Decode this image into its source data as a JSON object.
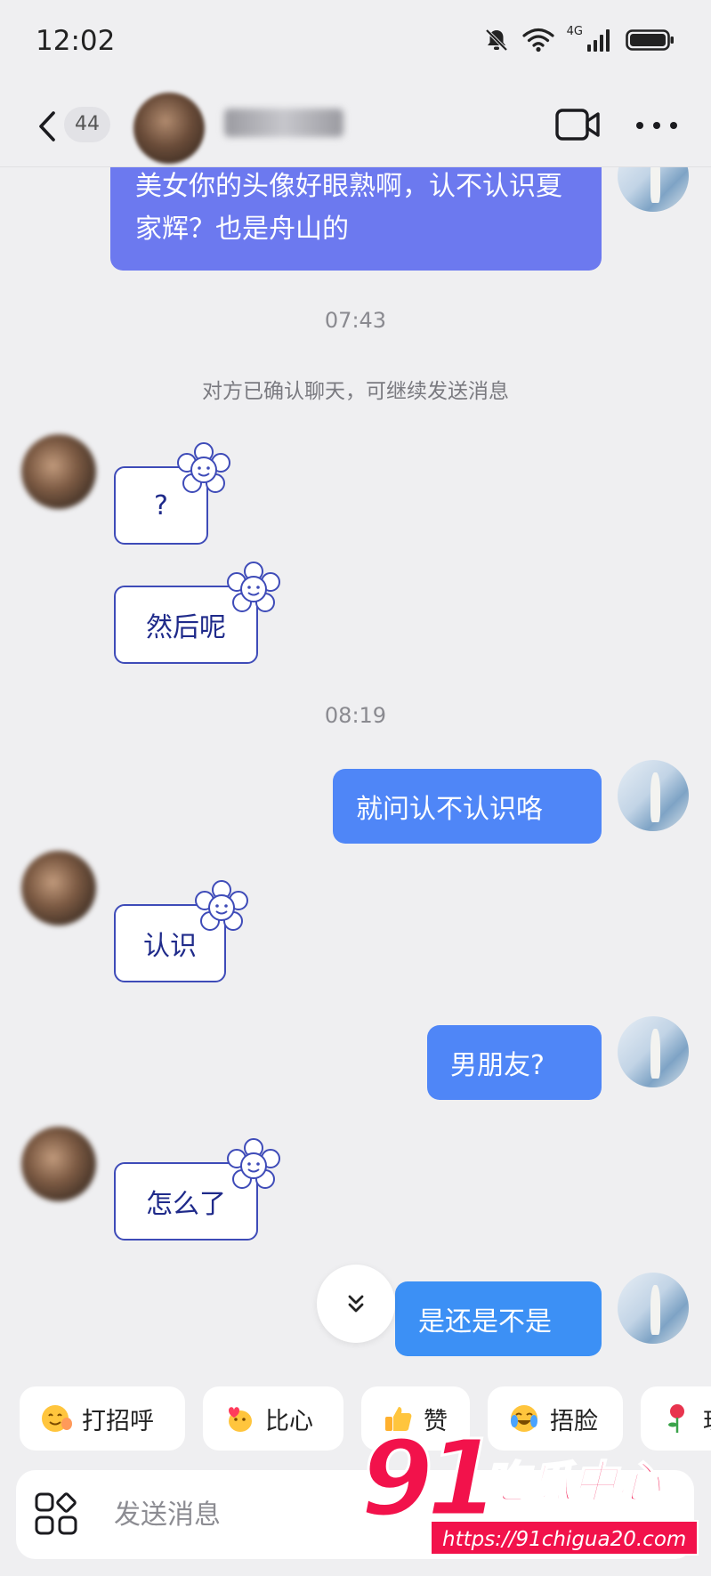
{
  "status_bar": {
    "time": "12:02",
    "network_label": "4G"
  },
  "header": {
    "unread_count": "44"
  },
  "messages": {
    "first_out": "美女你的头像好眼熟啊，认不认识夏家辉？也是舟山的",
    "time_1": "07:43",
    "system_note": "对方已确认聊天，可继续发送消息",
    "in_1": "?",
    "in_2": "然后呢",
    "time_2": "08:19",
    "out_1": "就问认不认识咯",
    "in_3": "认识",
    "out_2": "男朋友?",
    "in_4": "怎么了",
    "out_3": "是还是不是"
  },
  "quick_replies": [
    {
      "label": "打招呼",
      "icon": "wave-emoji-icon"
    },
    {
      "label": "比心",
      "icon": "heart-hands-emoji-icon"
    },
    {
      "label": "赞",
      "icon": "thumbs-up-emoji-icon"
    },
    {
      "label": "捂脸",
      "icon": "facepalm-emoji-icon"
    },
    {
      "label": "玫",
      "icon": "rose-emoji-icon"
    }
  ],
  "input": {
    "placeholder": "发送消息"
  },
  "watermark": {
    "number": "91",
    "text": "吃瓜中心",
    "url": "https://91chigua20.com"
  },
  "colors": {
    "background": "#efeff1",
    "bubble_first": "#6c79ef",
    "bubble_blue": "#4f86f7",
    "bubble_azure": "#3c90f5",
    "incoming_border": "#3e4bb8",
    "incoming_text": "#1f2a8a",
    "watermark_red": "#f2124b"
  }
}
